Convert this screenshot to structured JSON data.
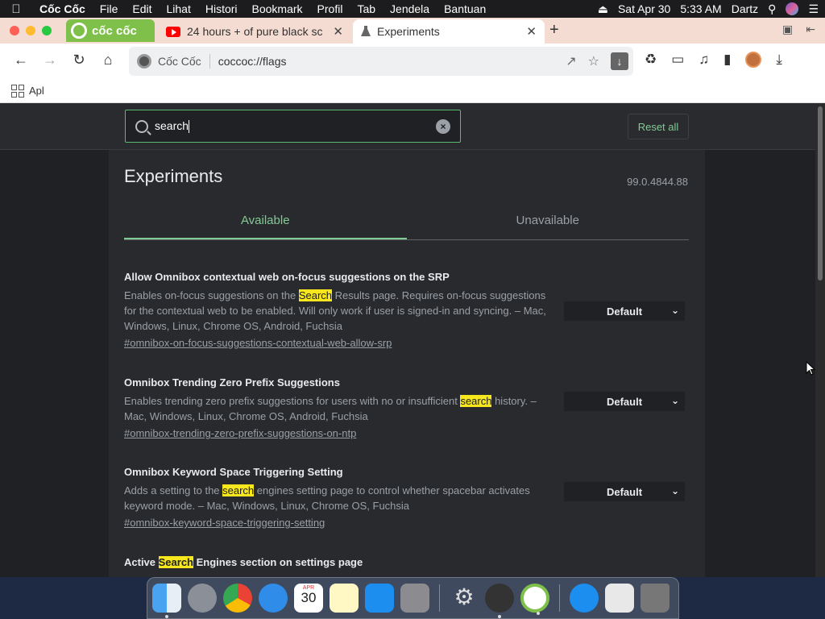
{
  "menubar": {
    "apple": "",
    "app_name": "Cốc Cốc",
    "items": [
      "File",
      "Edit",
      "Lihat",
      "Histori",
      "Bookmark",
      "Profil",
      "Tab",
      "Jendela",
      "Bantuan"
    ],
    "date": "Sat Apr 30",
    "time": "5:33 AM",
    "user": "Dartz"
  },
  "tabs": {
    "brand_label": "cốc cốc",
    "youtube_title": "24 hours + of pure black sc",
    "active_title": "Experiments",
    "close_glyph": "✕",
    "new_tab_glyph": "+"
  },
  "toolbar": {
    "back": "←",
    "forward": "→",
    "reload": "↻",
    "home": "⌂",
    "site_name": "Cốc Cốc",
    "url": "coccoc://flags",
    "download_chip": "↓"
  },
  "bookmarks": {
    "apps_label": "Apl"
  },
  "flags": {
    "search_value": "search",
    "reset_label": "Reset all",
    "title": "Experiments",
    "version": "99.0.4844.88",
    "tab_available": "Available",
    "tab_unavailable": "Unavailable",
    "experiments": [
      {
        "name": "Allow Omnibox contextual web on-focus suggestions on the SRP",
        "desc_before": "Enables on-focus suggestions on the ",
        "highlight": "Search",
        "desc_after": " Results page. Requires on-focus suggestions for the contextual web to be enabled. Will only work if user is signed-in and syncing. – Mac, Windows, Linux, Chrome OS, Android, Fuchsia",
        "link": "#omnibox-on-focus-suggestions-contextual-web-allow-srp",
        "value": "Default"
      },
      {
        "name": "Omnibox Trending Zero Prefix Suggestions",
        "desc_before": "Enables trending zero prefix suggestions for users with no or insufficient ",
        "highlight": "search",
        "desc_after": " history. – Mac, Windows, Linux, Chrome OS, Android, Fuchsia",
        "link": "#omnibox-trending-zero-prefix-suggestions-on-ntp",
        "value": "Default"
      },
      {
        "name": "Omnibox Keyword Space Triggering Setting",
        "desc_before": "Adds a setting to the ",
        "highlight": "search",
        "desc_after": " engines setting page to control whether spacebar activates keyword mode. – Mac, Windows, Linux, Chrome OS, Fuchsia",
        "link": "#omnibox-keyword-space-triggering-setting",
        "value": "Default"
      },
      {
        "name_before": "Active ",
        "name_highlight": "Search",
        "name_after": " Engines section on settings page"
      }
    ]
  },
  "dock": {
    "calendar_month": "APR",
    "calendar_day": "30"
  }
}
